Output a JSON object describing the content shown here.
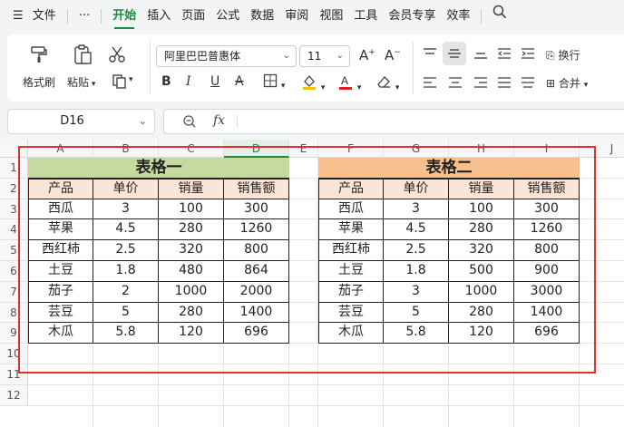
{
  "menubar": {
    "file_label": "文件",
    "more_label": "···",
    "tabs": [
      {
        "label": "开始",
        "name": "tab-home",
        "active": true
      },
      {
        "label": "插入",
        "name": "tab-insert"
      },
      {
        "label": "页面",
        "name": "tab-page"
      },
      {
        "label": "公式",
        "name": "tab-formula"
      },
      {
        "label": "数据",
        "name": "tab-data"
      },
      {
        "label": "审阅",
        "name": "tab-review"
      },
      {
        "label": "视图",
        "name": "tab-view"
      },
      {
        "label": "工具",
        "name": "tab-tools"
      },
      {
        "label": "会员专享",
        "name": "tab-member"
      },
      {
        "label": "效率",
        "name": "tab-efficiency"
      }
    ],
    "search_icon": "search-icon"
  },
  "ribbon": {
    "format_painter_label": "格式刷",
    "paste_label": "粘贴",
    "font_name": "阿里巴巴普惠体",
    "font_size": "11",
    "wrap_label": "换行",
    "merge_label": "合并"
  },
  "formula_bar": {
    "name_box": "D16",
    "fx_label": "fx",
    "formula_value": ""
  },
  "grid": {
    "columns": [
      "A",
      "B",
      "C",
      "D",
      "E",
      "F",
      "G",
      "H",
      "I",
      "J"
    ],
    "selected_column": "D",
    "rows": [
      "1",
      "2",
      "3",
      "4",
      "5",
      "6",
      "7",
      "8",
      "9",
      "10",
      "11",
      "12"
    ]
  },
  "table1": {
    "title": "表格一",
    "title_color": "#c5d9a0",
    "headers": [
      "产品",
      "单价",
      "销量",
      "销售额"
    ],
    "rows": [
      [
        "西瓜",
        "3",
        "100",
        "300"
      ],
      [
        "苹果",
        "4.5",
        "280",
        "1260"
      ],
      [
        "西红柿",
        "2.5",
        "320",
        "800"
      ],
      [
        "土豆",
        "1.8",
        "480",
        "864"
      ],
      [
        "茄子",
        "2",
        "1000",
        "2000"
      ],
      [
        "芸豆",
        "5",
        "280",
        "1400"
      ],
      [
        "木瓜",
        "5.8",
        "120",
        "696"
      ]
    ]
  },
  "table2": {
    "title": "表格二",
    "title_color": "#f9c08f",
    "headers": [
      "产品",
      "单价",
      "销量",
      "销售额"
    ],
    "rows": [
      [
        "西瓜",
        "3",
        "100",
        "300"
      ],
      [
        "苹果",
        "4.5",
        "280",
        "1260"
      ],
      [
        "西红柿",
        "2.5",
        "320",
        "800"
      ],
      [
        "土豆",
        "1.8",
        "500",
        "900"
      ],
      [
        "茄子",
        "3",
        "1000",
        "3000"
      ],
      [
        "芸豆",
        "5",
        "280",
        "1400"
      ],
      [
        "木瓜",
        "5.8",
        "120",
        "696"
      ]
    ]
  },
  "colors": {
    "accent": "#1a8c3a",
    "header_fill": "#fbe5d6",
    "highlight_box": "#e03030"
  }
}
